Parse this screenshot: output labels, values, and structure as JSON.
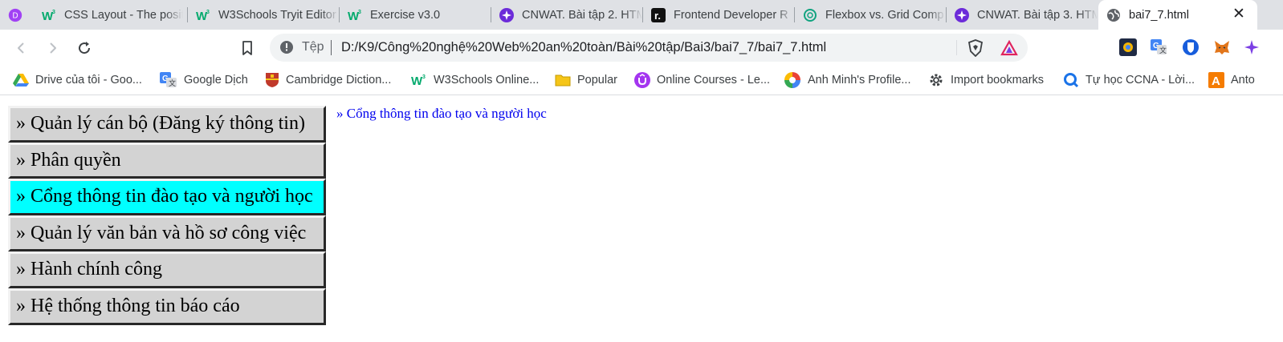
{
  "browser": {
    "tabs": [
      {
        "title": "",
        "icon": "profile-avatar-icon",
        "active": false
      },
      {
        "title": "CSS Layout - The posit",
        "icon": "w3schools-icon",
        "active": false
      },
      {
        "title": "W3Schools Tryit Editor",
        "icon": "w3schools-icon",
        "active": false
      },
      {
        "title": "Exercise v3.0",
        "icon": "w3schools-icon",
        "active": false
      },
      {
        "title": "CNWAT. Bài tập 2. HTM",
        "icon": "sparkle-icon",
        "active": false
      },
      {
        "title": "Frontend Developer R",
        "icon": "roadmap-icon",
        "active": false
      },
      {
        "title": "Flexbox vs. Grid Comp",
        "icon": "chatgpt-icon",
        "active": false
      },
      {
        "title": "CNWAT. Bài tập 3. HTM",
        "icon": "sparkle-icon",
        "active": false
      },
      {
        "title": "bai7_7.html",
        "icon": "globe-icon",
        "active": true
      }
    ],
    "avatar_letter": "D",
    "close_glyph": "✕",
    "address": {
      "scheme_label": "Tệp",
      "url": "D:/K9/Công%20nghệ%20Web%20an%20toàn/Bài%20tập/Bai3/bai7_7/bai7_7.html"
    },
    "bookmarks": [
      {
        "label": "Drive của tôi - Goo...",
        "icon": "google-drive-icon"
      },
      {
        "label": "Google Dịch",
        "icon": "google-translate-icon"
      },
      {
        "label": "Cambridge Diction...",
        "icon": "cambridge-icon"
      },
      {
        "label": "W3Schools Online...",
        "icon": "w3schools-icon"
      },
      {
        "label": "Popular",
        "icon": "folder-icon"
      },
      {
        "label": "Online Courses - Le...",
        "icon": "udemy-icon"
      },
      {
        "label": "Anh Minh's Profile...",
        "icon": "swirl-icon"
      },
      {
        "label": "Import bookmarks",
        "icon": "gear-icon"
      },
      {
        "label": "Tự học CCNA - Lời...",
        "icon": "ccna-icon"
      },
      {
        "label": "Anto",
        "icon": "anto-icon"
      }
    ],
    "colors": {
      "tabstrip_bg": "#dfe1e5",
      "active_menu_bg": "#00ffff",
      "menu_bg": "#d3d3d3",
      "content_link": "#0000ee"
    }
  },
  "page": {
    "menu": [
      {
        "label": "» Quản lý cán bộ (Đăng ký thông tin)",
        "active": false
      },
      {
        "label": "» Phân quyền",
        "active": false
      },
      {
        "label": "» Cổng thông tin đào tạo và người học",
        "active": true
      },
      {
        "label": "» Quản lý văn bản và hồ sơ công việc",
        "active": false
      },
      {
        "label": "» Hành chính công",
        "active": false
      },
      {
        "label": "» Hệ thống thông tin báo cáo",
        "active": false
      }
    ],
    "content_title": "» Cổng thông tin đào tạo và người học"
  }
}
